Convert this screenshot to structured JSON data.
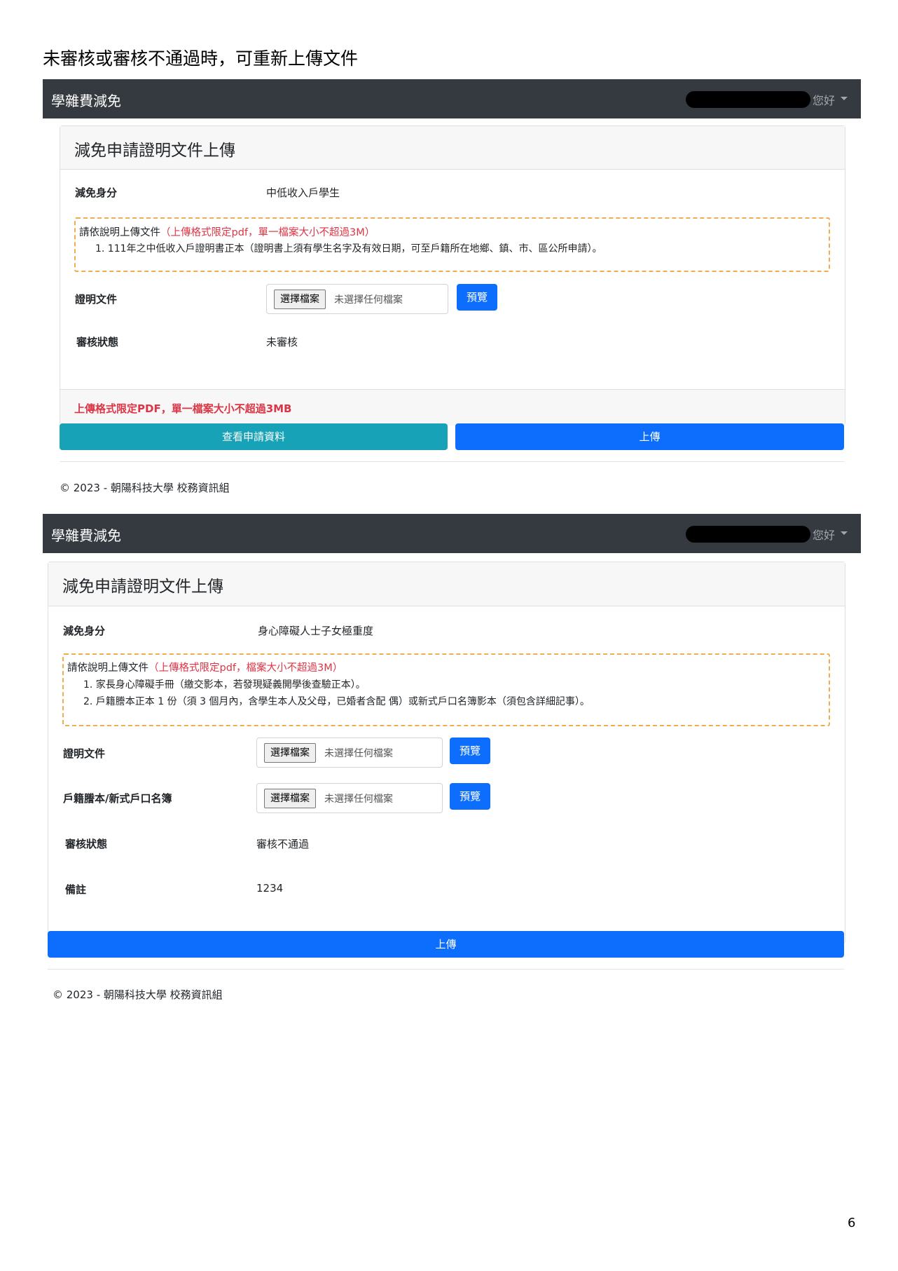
{
  "doc_heading": "未審核或審核不通過時，可重新上傳文件",
  "page_number": "6",
  "colors": {
    "navbar": "#343a40",
    "primary": "#0d6efd",
    "info": "#17a2b8",
    "danger": "#dc3545",
    "notice_border": "#f0ad4e"
  },
  "screen1": {
    "brand": "學雜費減免",
    "greeting": "您好",
    "card_title": "減免申請證明文件上傳",
    "identity_label": "減免身分",
    "identity_value": "中低收入戶學生",
    "notice_prefix": "請依說明上傳文件",
    "notice_red": "（上傳格式限定pdf，單一檔案大小不超過3M）",
    "notice_items": [
      "1. 111年之中低收入戶證明書正本（證明書上須有學生名字及有效日期，可至戶籍所在地鄉、鎮、市、區公所申請）。"
    ],
    "proof_label": "證明文件",
    "file_button": "選擇檔案",
    "file_none": "未選擇任何檔案",
    "preview": "預覽",
    "status_label": "審核狀態",
    "status_value": "未審核",
    "footer_note": "上傳格式限定PDF，單一檔案大小不超過3MB",
    "view_button": "查看申請資料",
    "upload_button": "上傳",
    "copyright": "© 2023 - 朝陽科技大學 校務資訊組"
  },
  "screen2": {
    "brand": "學雜費減免",
    "greeting": "您好",
    "card_title": "減免申請證明文件上傳",
    "identity_label": "減免身分",
    "identity_value": "身心障礙人士子女極重度",
    "notice_prefix": "請依說明上傳文件",
    "notice_red": "（上傳格式限定pdf，檔案大小不超過3M）",
    "notice_items": [
      "1. 家長身心障礙手冊（繳交影本，若發現疑義開學後查驗正本）。",
      "2. 戶籍謄本正本 1 份（須 3 個月內，含學生本人及父母，已婚者含配 偶）或新式戶口名簿影本（須包含詳細記事）。"
    ],
    "proof_label": "證明文件",
    "household_label": "戶籍謄本/新式戶口名簿",
    "file_button": "選擇檔案",
    "file_none": "未選擇任何檔案",
    "preview": "預覽",
    "status_label": "審核狀態",
    "status_value": "審核不通過",
    "remark_label": "備註",
    "remark_value": "1234",
    "upload_button": "上傳",
    "copyright": "© 2023 - 朝陽科技大學 校務資訊組"
  }
}
